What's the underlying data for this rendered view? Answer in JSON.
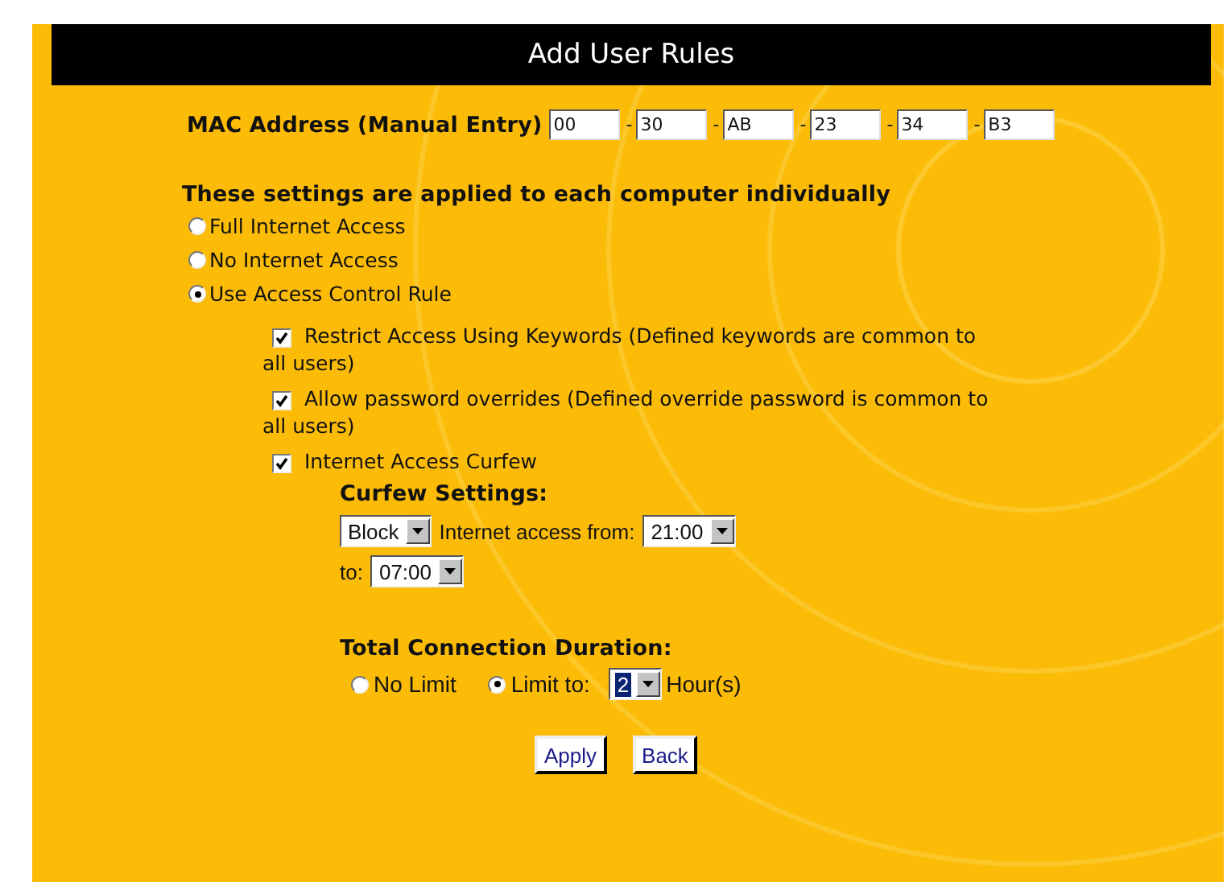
{
  "title": "Add User Rules",
  "mac": {
    "label": "MAC Address (Manual Entry)",
    "octets": [
      "00",
      "30",
      "AB",
      "23",
      "34",
      "B3"
    ],
    "separator": "-"
  },
  "section_heading": "These settings are applied to each computer individually",
  "access_options": [
    {
      "label": "Full Internet Access",
      "selected": false
    },
    {
      "label": "No Internet Access",
      "selected": false
    },
    {
      "label": "Use Access Control Rule",
      "selected": true
    }
  ],
  "rule_options": [
    {
      "label": "Restrict Access Using Keywords (Defined keywords are common to all users)",
      "checked": true
    },
    {
      "label": "Allow password overrides (Defined override password is common to all users)",
      "checked": true
    },
    {
      "label": "Internet Access Curfew",
      "checked": true
    }
  ],
  "curfew": {
    "heading": "Curfew Settings:",
    "action": "Block",
    "from_label": "Internet access from:",
    "from": "21:00",
    "to_label": "to:",
    "to": "07:00"
  },
  "duration": {
    "heading": "Total Connection Duration:",
    "options": [
      {
        "label": "No Limit",
        "selected": false
      },
      {
        "label": "Limit to:",
        "selected": true
      }
    ],
    "hours": {
      "value": "2",
      "focused": true
    },
    "unit": "Hour(s)"
  },
  "buttons": [
    "Apply",
    "Back"
  ]
}
